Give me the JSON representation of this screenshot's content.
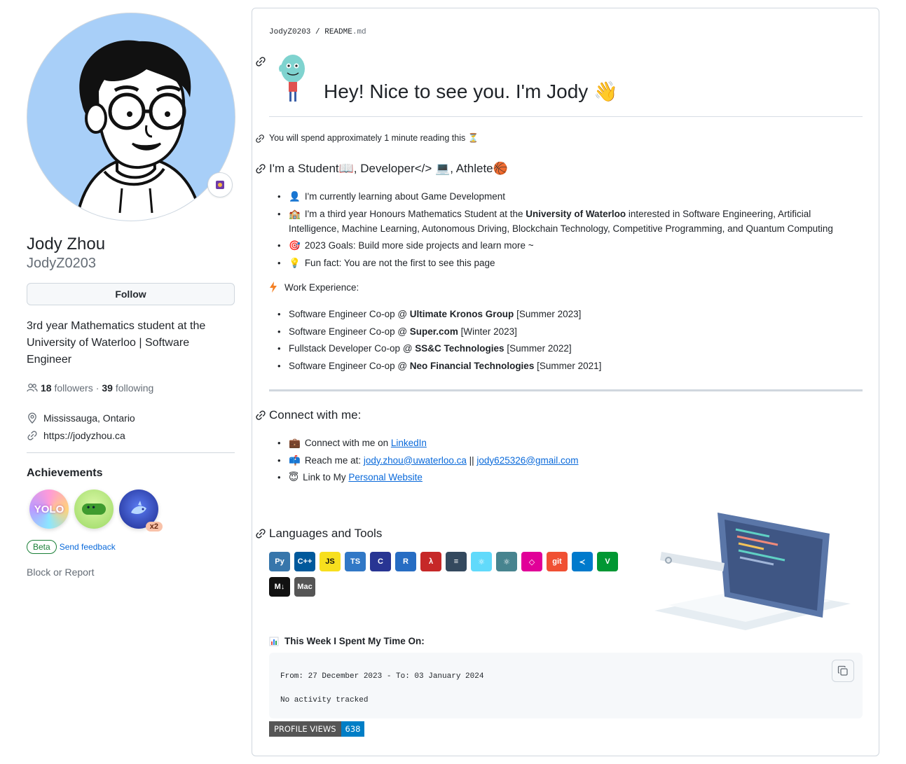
{
  "profile": {
    "full_name": "Jody Zhou",
    "login": "JodyZ0203",
    "follow_label": "Follow",
    "bio": "3rd year Mathematics student at the University of Waterloo | Software Engineer",
    "followers_count": "18",
    "followers_label": "followers",
    "separator": "·",
    "following_count": "39",
    "following_label": "following",
    "location": "Mississauga, Ontario",
    "website": "https://jodyzhou.ca",
    "achievements_title": "Achievements",
    "badges": [
      {
        "name": "yolo",
        "label": "YOLO"
      },
      {
        "name": "pair-extraordinaire",
        "label": ""
      },
      {
        "name": "pull-shark",
        "label": "",
        "count": "x2"
      }
    ],
    "beta_label": "Beta",
    "send_feedback": "Send feedback",
    "block_report": "Block or Report"
  },
  "readme": {
    "crumb_user": "JodyZ0203",
    "crumb_sep": " / ",
    "crumb_file": "README",
    "crumb_ext": ".md",
    "heading": "Hey! Nice to see you. I'm Jody 👋",
    "read_time": "You will spend approximately 1 minute reading this ⏳",
    "intro_heading": "I'm a Student📖, Developer</> 💻, Athlete🏀",
    "about": [
      {
        "emoji": "👤",
        "parts": [
          {
            "t": "I'm currently learning about Game Development"
          }
        ]
      },
      {
        "emoji": "🏫",
        "parts": [
          {
            "t": "I'm a third year Honours Mathematics Student at the "
          },
          {
            "t": "University of Waterloo",
            "b": true
          },
          {
            "t": " interested in Software Engineering, Artificial Intelligence, Machine Learning, Autonomous Driving, Blockchain Technology, Competitive Programming, and Quantum Computing"
          }
        ]
      },
      {
        "emoji": "🎯",
        "parts": [
          {
            "t": "2023 Goals: Build more side projects and learn more ~"
          }
        ]
      },
      {
        "emoji": "💡",
        "parts": [
          {
            "t": "Fun fact: You are not the first to see this page"
          }
        ]
      }
    ],
    "work_label": "Work Experience:",
    "work": [
      {
        "role": "Software Engineer Co-op @ ",
        "company": "Ultimate Kronos Group",
        "term": " [Summer 2023]"
      },
      {
        "role": "Software Engineer Co-op @ ",
        "company": "Super.com",
        "term": " [Winter 2023]"
      },
      {
        "role": "Fullstack Developer Co-op @ ",
        "company": "SS&C Technologies",
        "term": " [Summer 2022]"
      },
      {
        "role": "Software Engineer Co-op @ ",
        "company": "Neo Financial Technologies",
        "term": " [Summer 2021]"
      }
    ],
    "connect_heading": "Connect with me:",
    "connect": {
      "linkedin_prefix": "Connect with me on ",
      "linkedin_link": "LinkedIn",
      "reach_prefix": "Reach me at: ",
      "email1": "jody.zhou@uwaterloo.ca",
      "email_sep": " || ",
      "email2": "jody625326@gmail.com",
      "site_prefix": "Link to My ",
      "site_link": "Personal Website"
    },
    "tools_heading": "Languages and Tools",
    "tools": [
      {
        "name": "python",
        "label": "Py",
        "color": "#3776ab"
      },
      {
        "name": "cplusplus",
        "label": "C++",
        "color": "#00599c"
      },
      {
        "name": "javascript",
        "label": "JS",
        "color": "#f7df1e"
      },
      {
        "name": "typescript",
        "label": "TS",
        "color": "#3178c6"
      },
      {
        "name": "c",
        "label": "C",
        "color": "#283593"
      },
      {
        "name": "r",
        "label": "R",
        "color": "#276dc3"
      },
      {
        "name": "racket",
        "label": "λ",
        "color": "#c62828"
      },
      {
        "name": "sql",
        "label": "≡",
        "color": "#34495e"
      },
      {
        "name": "react",
        "label": "⚛",
        "color": "#61dafb"
      },
      {
        "name": "electron",
        "label": "⚛",
        "color": "#47848f"
      },
      {
        "name": "graphql",
        "label": "◇",
        "color": "#e10098"
      },
      {
        "name": "git",
        "label": "git",
        "color": "#f05033"
      },
      {
        "name": "vscode",
        "label": "≺",
        "color": "#007acc"
      },
      {
        "name": "vim",
        "label": "V",
        "color": "#019733"
      },
      {
        "name": "markdown",
        "label": "M↓",
        "color": "#111111"
      },
      {
        "name": "mac",
        "label": "Mac",
        "color": "#555555"
      }
    ],
    "week_heading": "This Week I Spent My Time On:",
    "code_line1": "From: 27 December 2023 - To: 03 January 2024",
    "code_line2": "No activity tracked",
    "views_key": "PROFILE VIEWS",
    "views_value": "638"
  },
  "colors": {
    "link": "#0969da",
    "beta": "#1a7f37",
    "avatar_bg": "#a8cff8",
    "views_value_bg": "#007ec6"
  },
  "icons": [
    "link-icon",
    "people-icon",
    "location-icon",
    "copy-icon",
    "zap-icon",
    "chart-icon",
    "laptop-illustration",
    "mascot-illustration"
  ]
}
